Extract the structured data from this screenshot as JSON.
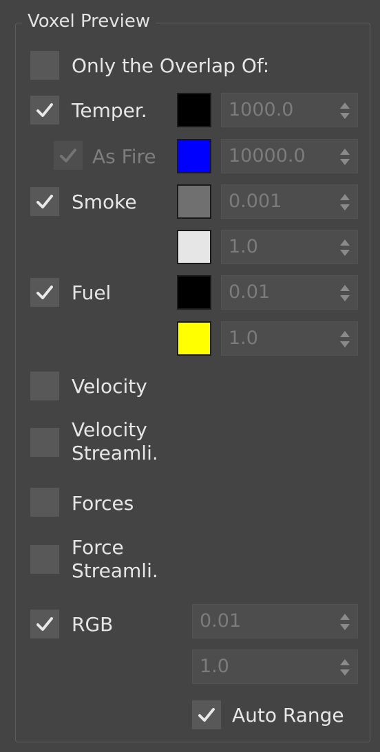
{
  "panel": {
    "title": "Voxel Preview",
    "overlap_label": "Only the Overlap Of:"
  },
  "rows": {
    "temper": {
      "label": "Temper.",
      "checked": true,
      "color": "#000000",
      "value": "1000.0"
    },
    "as_fire": {
      "label": "As Fire",
      "checked": true,
      "disabled": true,
      "color": "#0000ff",
      "value": "10000.0"
    },
    "smoke": {
      "label": "Smoke",
      "checked": true,
      "color": "#707070",
      "value_min": "0.001",
      "color2": "#e6e6e6",
      "value_max": "1.0"
    },
    "fuel": {
      "label": "Fuel",
      "checked": true,
      "color": "#000000",
      "value_min": "0.01",
      "color2": "#ffff00",
      "value_max": "1.0"
    },
    "velocity": {
      "label": "Velocity",
      "checked": false
    },
    "velocity_stream": {
      "label": "Velocity Streamli.",
      "checked": false
    },
    "forces": {
      "label": "Forces",
      "checked": false
    },
    "force_stream": {
      "label": "Force Streamli.",
      "checked": false
    },
    "rgb": {
      "label": "RGB",
      "checked": true,
      "value_min": "0.01",
      "value_max": "1.0"
    },
    "auto_range": {
      "label": "Auto Range",
      "checked": true
    }
  },
  "icons": {
    "check": "checkmark-icon",
    "spinner": "spinner-arrows-icon"
  }
}
